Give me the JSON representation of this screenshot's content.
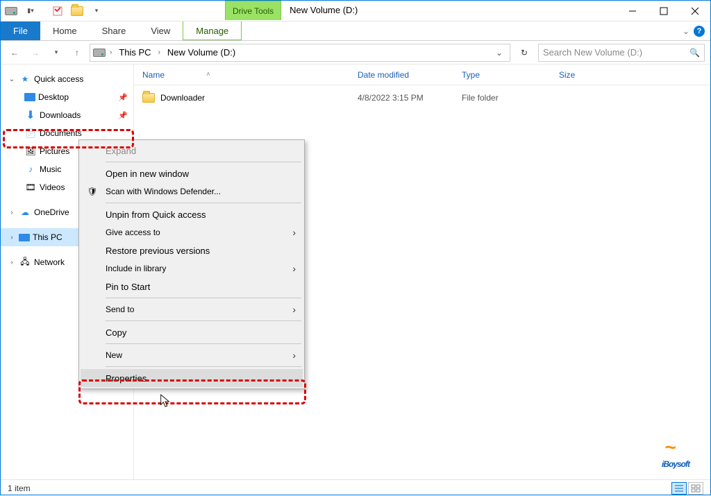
{
  "titlebar": {
    "context_tab": "Drive Tools",
    "window_title": "New Volume (D:)"
  },
  "ribbon": {
    "file": "File",
    "tabs": [
      "Home",
      "Share",
      "View",
      "Manage"
    ]
  },
  "address": {
    "crumbs": [
      "This PC",
      "New Volume (D:)"
    ]
  },
  "search": {
    "placeholder": "Search New Volume (D:)"
  },
  "tree": {
    "quick_access": "Quick access",
    "items": [
      {
        "label": "Desktop",
        "pin": true
      },
      {
        "label": "Downloads",
        "pin": true
      },
      {
        "label": "Documents",
        "pin": true
      },
      {
        "label": "Pictures",
        "pin": true
      },
      {
        "label": "Music"
      },
      {
        "label": "Videos"
      }
    ],
    "onedrive": "OneDrive",
    "this_pc": "This PC",
    "network": "Network"
  },
  "columns": {
    "name": "Name",
    "date": "Date modified",
    "type": "Type",
    "size": "Size"
  },
  "rows": [
    {
      "name": "Downloader",
      "date": "4/8/2022 3:15 PM",
      "type": "File folder",
      "size": ""
    }
  ],
  "context_menu": {
    "expand": "Expand",
    "open_new": "Open in new window",
    "defender": "Scan with Windows Defender...",
    "unpin": "Unpin from Quick access",
    "give_access": "Give access to",
    "restore": "Restore previous versions",
    "include": "Include in library",
    "pin_start": "Pin to Start",
    "send_to": "Send to",
    "copy": "Copy",
    "new": "New",
    "properties": "Properties"
  },
  "status": {
    "count": "1 item"
  },
  "watermark": "iBoysoft"
}
